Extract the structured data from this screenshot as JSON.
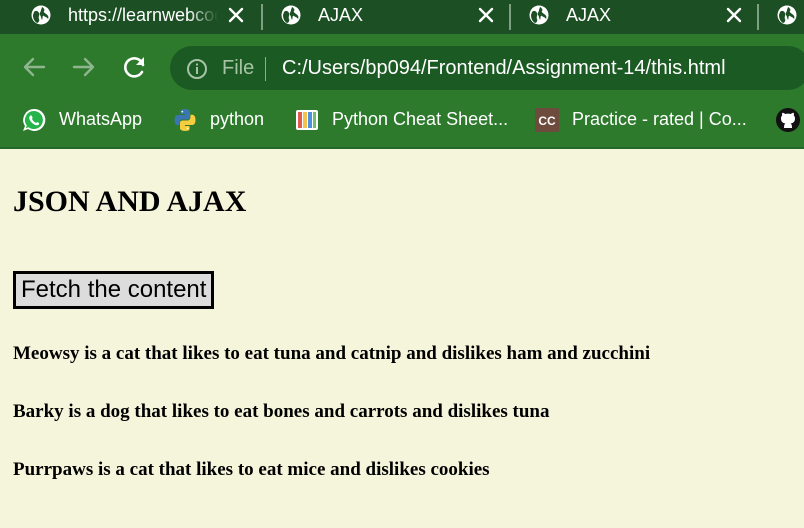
{
  "tabs": [
    {
      "title": "https://learnwebcode.github.io/json-example/pets-data.json"
    },
    {
      "title": "AJAX"
    },
    {
      "title": "AJAX"
    }
  ],
  "toolbar": {
    "file_label": "File",
    "url": "C:/Users/bp094/Frontend/Assignment-14/this.html"
  },
  "bookmarks": [
    {
      "label": "WhatsApp",
      "icon": "whatsapp-icon"
    },
    {
      "label": "python",
      "icon": "python-icon"
    },
    {
      "label": "Python Cheat Sheet...",
      "icon": "cheat-sheet-icon"
    },
    {
      "label": "Practice - rated | Co...",
      "icon": "codechef-icon"
    }
  ],
  "page": {
    "heading": "JSON AND AJAX",
    "fetch_button": "Fetch the content",
    "pets": [
      "Meowsy is a cat that likes to eat tuna and catnip and dislikes ham and zucchini",
      "Barky is a dog that likes to eat bones and carrots and dislikes tuna",
      "Purrpaws is a cat that likes to eat mice and dislikes cookies"
    ]
  },
  "colors": {
    "tab_strip": "#1c4f24",
    "toolbar": "#2d7a2d",
    "omnibox": "#1c5a24",
    "page_background": "#f5f5dc"
  }
}
